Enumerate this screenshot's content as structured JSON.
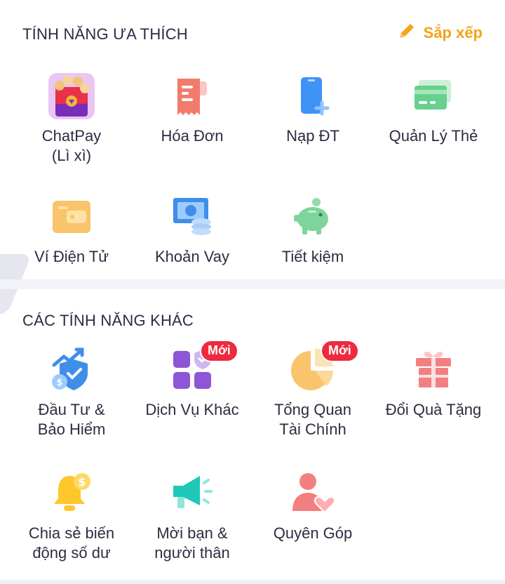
{
  "favorites": {
    "title": "TÍNH NĂNG ƯA THÍCH",
    "sort_label": "Sắp xếp",
    "items": [
      {
        "line1": "ChatPay",
        "line2": "(Lì xì)",
        "icon": "chatpay-lixi-icon"
      },
      {
        "line1": "Hóa Đơn",
        "line2": "",
        "icon": "bill-icon"
      },
      {
        "line1": "Nạp ĐT",
        "line2": "",
        "icon": "phone-topup-icon"
      },
      {
        "line1": "Quản Lý Thẻ",
        "line2": "",
        "icon": "card-icon"
      },
      {
        "line1": "Ví Điện Tử",
        "line2": "",
        "icon": "wallet-icon"
      },
      {
        "line1": "Khoản Vay",
        "line2": "",
        "icon": "loan-icon"
      },
      {
        "line1": "Tiết kiệm",
        "line2": "",
        "icon": "piggy-bank-icon"
      }
    ]
  },
  "others": {
    "title": "CÁC TÍNH NĂNG KHÁC",
    "items": [
      {
        "line1": "Đầu Tư &",
        "line2": "Bảo Hiểm",
        "icon": "invest-insurance-icon",
        "badge": ""
      },
      {
        "line1": "Dịch Vụ Khác",
        "line2": "",
        "icon": "other-services-icon",
        "badge": "Mới"
      },
      {
        "line1": "Tổng Quan",
        "line2": "Tài Chính",
        "icon": "pie-chart-icon",
        "badge": "Mới"
      },
      {
        "line1": "Đổi Quà Tặng",
        "line2": "",
        "icon": "gift-icon",
        "badge": ""
      },
      {
        "line1": "Chia sẻ biến",
        "line2": "động số dư",
        "icon": "bell-icon",
        "badge": ""
      },
      {
        "line1": "Mời bạn &",
        "line2": "người thân",
        "icon": "megaphone-icon",
        "badge": ""
      },
      {
        "line1": "Quyên Góp",
        "line2": "",
        "icon": "donate-icon",
        "badge": ""
      }
    ]
  },
  "colors": {
    "accent": "#f5a318",
    "badge": "#ee2a3f",
    "title": "#2a2b45"
  }
}
